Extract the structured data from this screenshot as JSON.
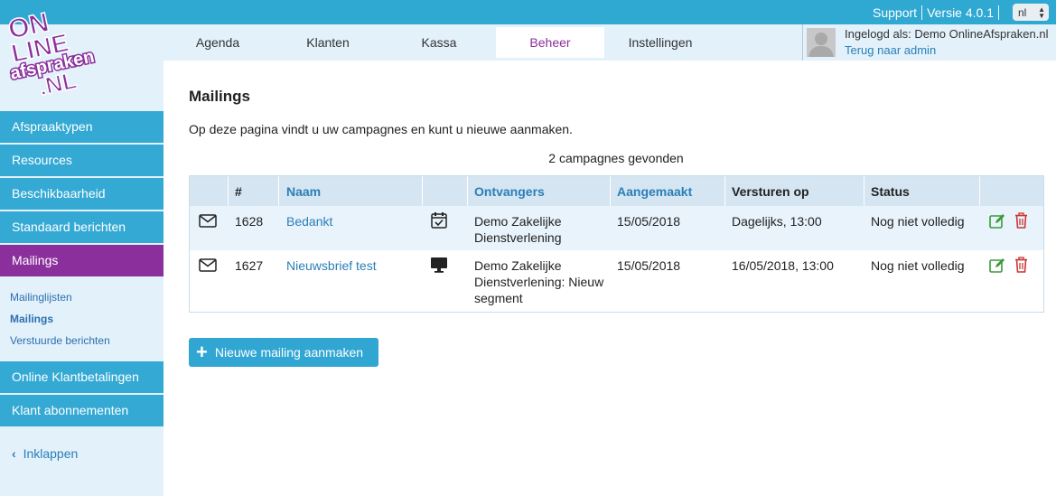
{
  "topbar": {
    "support": "Support",
    "version": "Versie 4.0.1",
    "language": "nl"
  },
  "logo": {
    "line1": "ON",
    "line2": "LINE",
    "line3": "afspraken",
    "line4": ".NL"
  },
  "nav": {
    "tabs": [
      {
        "label": "Agenda"
      },
      {
        "label": "Klanten"
      },
      {
        "label": "Kassa"
      },
      {
        "label": "Beheer"
      },
      {
        "label": "Instellingen"
      }
    ]
  },
  "user": {
    "logged_in_as": "Ingelogd als: Demo OnlineAfspraken.nl",
    "back_to_admin": "Terug naar admin"
  },
  "sidebar": {
    "items": [
      {
        "label": "Afspraaktypen"
      },
      {
        "label": "Resources"
      },
      {
        "label": "Beschikbaarheid"
      },
      {
        "label": "Standaard berichten"
      },
      {
        "label": "Mailings"
      }
    ],
    "sub_items": [
      {
        "label": "Mailinglijsten"
      },
      {
        "label": "Mailings"
      },
      {
        "label": "Verstuurde berichten"
      }
    ],
    "items_bottom": [
      {
        "label": "Online Klantbetalingen"
      },
      {
        "label": "Klant abonnementen"
      }
    ],
    "collapse_label": "Inklappen"
  },
  "main": {
    "title": "Mailings",
    "intro": "Op deze pagina vindt u uw campagnes en kunt u nieuwe aanmaken.",
    "count": "2 campagnes gevonden",
    "new_button": "Nieuwe mailing aanmaken"
  },
  "table": {
    "headers": {
      "number": "#",
      "name": "Naam",
      "recipients": "Ontvangers",
      "created": "Aangemaakt",
      "send_at": "Versturen op",
      "status": "Status"
    },
    "rows": [
      {
        "id": "1628",
        "name": "Bedankt",
        "type_icon": "calendar-check-icon",
        "recipients_line1": "Demo Zakelijke",
        "recipients_line2": "Dienstverlening",
        "recipients_line3": "",
        "created": "15/05/2018",
        "send_at": "Dagelijks, 13:00",
        "status": "Nog niet volledig"
      },
      {
        "id": "1627",
        "name": "Nieuwsbrief test",
        "type_icon": "monitor-icon",
        "recipients_line1": "Demo Zakelijke",
        "recipients_line2": "Dienstverlening: Nieuw",
        "recipients_line3": "segment",
        "created": "15/05/2018",
        "send_at": "16/05/2018, 13:00",
        "status": "Nog niet volledig"
      }
    ]
  },
  "colors": {
    "accent_blue": "#34a9d4",
    "active_purple": "#8b2f9c",
    "link_blue": "#2a7fb8",
    "edit_green": "#3a9a3a",
    "delete_red": "#cc3333"
  }
}
